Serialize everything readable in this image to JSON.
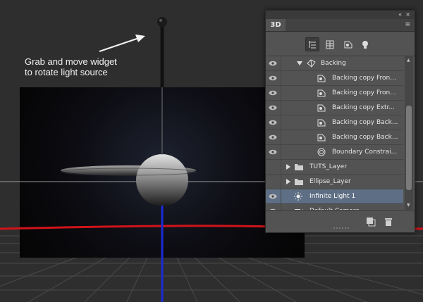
{
  "annotation": {
    "line1": "Grab and move widget",
    "line2": "to rotate light source"
  },
  "panel": {
    "tab_label": "3D",
    "collapse_label": "«",
    "close_label": "×",
    "menu_label": "≡"
  },
  "toolbar": {
    "buttons": [
      {
        "name": "scene-filter",
        "icon": "scene-tree-icon",
        "active": true
      },
      {
        "name": "mesh-filter",
        "icon": "mesh-icon",
        "active": false
      },
      {
        "name": "material-filter",
        "icon": "material-icon",
        "active": false
      },
      {
        "name": "light-filter",
        "icon": "light-bulb-icon",
        "active": false
      }
    ]
  },
  "layers": [
    {
      "label": "Backing",
      "icon": "scene-group-icon",
      "expanded": true
    },
    {
      "label": "Backing copy Fron...",
      "icon": "material-icon"
    },
    {
      "label": "Backing copy Fron...",
      "icon": "material-icon"
    },
    {
      "label": "Backing copy Extr...",
      "icon": "material-icon"
    },
    {
      "label": "Backing copy Back...",
      "icon": "material-icon"
    },
    {
      "label": "Backing copy Back...",
      "icon": "material-icon"
    },
    {
      "label": "Boundary Constrai...",
      "icon": "constraint-icon"
    },
    {
      "label": "TUTS_Layer",
      "icon": "folder-icon",
      "expanded": false
    },
    {
      "label": "Ellipse_Layer",
      "icon": "folder-icon",
      "expanded": false
    },
    {
      "label": "Infinite Light 1",
      "icon": "sun-icon",
      "selected": true
    },
    {
      "label": "Default Camera",
      "icon": "camera-icon"
    }
  ],
  "colors": {
    "panel_bg": "#535353",
    "selected_row": "#5e6e84",
    "ground_axis": "#d0141a",
    "vertical_axis": "#1a2ad8"
  }
}
